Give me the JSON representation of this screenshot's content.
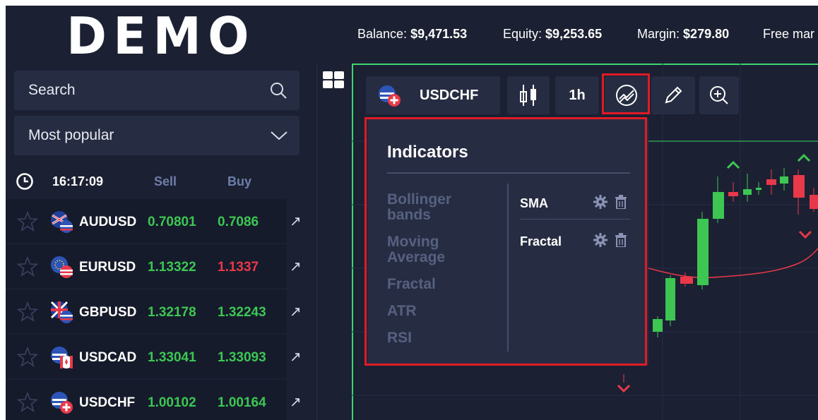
{
  "logo": "DEMO",
  "search": {
    "placeholder": "Search"
  },
  "filter": {
    "selected": "Most popular"
  },
  "quotes_header": {
    "time": "16:17:09",
    "sell_label": "Sell",
    "buy_label": "Buy"
  },
  "instruments": [
    {
      "symbol": "AUDUSD",
      "sell": "0.70801",
      "buy": "0.7086",
      "buy_color": "#3cc653",
      "flag_icon": "flag-au-us-icon"
    },
    {
      "symbol": "EURUSD",
      "sell": "1.13322",
      "buy": "1.1337",
      "buy_color": "#e8394a",
      "flag_icon": "flag-eu-us-icon"
    },
    {
      "symbol": "GBPUSD",
      "sell": "1.32178",
      "buy": "1.32243",
      "buy_color": "#3cc653",
      "flag_icon": "flag-gb-us-icon"
    },
    {
      "symbol": "USDCAD",
      "sell": "1.33041",
      "buy": "1.33093",
      "buy_color": "#3cc653",
      "flag_icon": "flag-us-ca-icon"
    },
    {
      "symbol": "USDCHF",
      "sell": "1.00102",
      "buy": "1.00164",
      "buy_color": "#3cc653",
      "flag_icon": "flag-us-ch-icon"
    }
  ],
  "account": {
    "balance_label": "Balance:",
    "balance": "$9,471.53",
    "equity_label": "Equity:",
    "equity": "$9,253.65",
    "margin_label": "Margin:",
    "margin": "$279.80",
    "free_margin_label": "Free mar"
  },
  "chart_toolbar": {
    "symbol": "USDCHF",
    "timeframe": "1h",
    "icons": [
      "candles-icon",
      "indicators-icon",
      "pencil-icon",
      "zoom-in-icon"
    ]
  },
  "indicators_panel": {
    "title": "Indicators",
    "available": [
      "Bollinger bands",
      "Moving Average",
      "Fractal",
      "ATR",
      "RSI"
    ],
    "active": [
      "SMA",
      "Fractal"
    ]
  },
  "colors": {
    "accent_green": "#3ec653",
    "accent_red": "#e8394a",
    "highlight": "#e01b24",
    "panel_bg": "#262c42",
    "app_bg": "#1b2033"
  }
}
